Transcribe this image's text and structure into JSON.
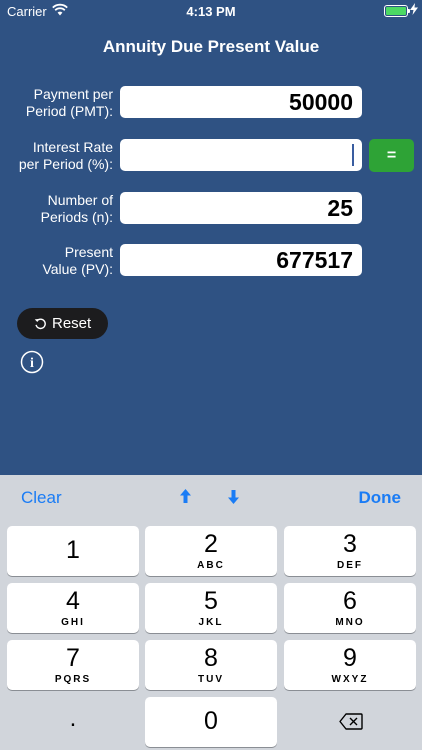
{
  "status": {
    "carrier": "Carrier",
    "time": "4:13 PM"
  },
  "title": "Annuity Due Present Value",
  "fields": {
    "pmt": {
      "label_line1": "Payment per",
      "label_line2": "Period (PMT):",
      "value": "50000"
    },
    "rate": {
      "label_line1": "Interest Rate",
      "label_line2": "per Period (%):",
      "value": ""
    },
    "periods": {
      "label_line1": "Number of",
      "label_line2": "Periods (n):",
      "value": "25"
    },
    "pv": {
      "label_line1": "Present",
      "label_line2": "Value (PV):",
      "value": "677517"
    }
  },
  "equals_label": "=",
  "reset_label": "Reset",
  "info_label": "i",
  "toolbar": {
    "clear": "Clear",
    "done": "Done"
  },
  "keys": [
    {
      "num": "1",
      "letters": ""
    },
    {
      "num": "2",
      "letters": "ABC"
    },
    {
      "num": "3",
      "letters": "DEF"
    },
    {
      "num": "4",
      "letters": "GHI"
    },
    {
      "num": "5",
      "letters": "JKL"
    },
    {
      "num": "6",
      "letters": "MNO"
    },
    {
      "num": "7",
      "letters": "PQRS"
    },
    {
      "num": "8",
      "letters": "TUV"
    },
    {
      "num": "9",
      "letters": "WXYZ"
    },
    {
      "num": "0",
      "letters": ""
    }
  ],
  "decimal_label": ".",
  "colors": {
    "background": "#2f5283",
    "equals": "#2ea336",
    "toolbar_text": "#1a7cf5"
  },
  "icons": {
    "wifi": "wifi-icon",
    "battery": "battery-icon",
    "reset": "refresh-icon",
    "info": "info-icon",
    "up": "arrow-up-icon",
    "down": "arrow-down-icon",
    "backspace": "backspace-icon"
  }
}
